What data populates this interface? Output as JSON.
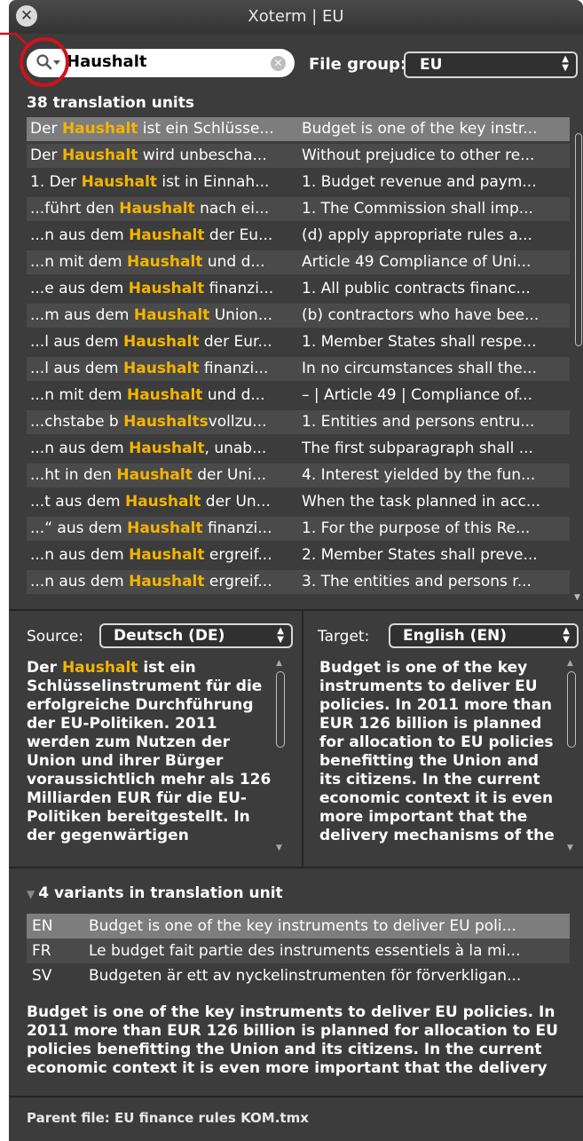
{
  "window": {
    "title": "Xoterm | EU"
  },
  "search": {
    "value": "Haushalt"
  },
  "file_group": {
    "label": "File group:",
    "value": "EU"
  },
  "count_label": "38 translation units",
  "rows": [
    {
      "src_pre": "Der ",
      "src_hl": "Haushalt",
      "src_post": " ist ein Schlüsse...",
      "tgt": "Budget is one of the key instr..."
    },
    {
      "src_pre": "Der ",
      "src_hl": "Haushalt",
      "src_post": " wird unbescha...",
      "tgt": "Without prejudice to other re..."
    },
    {
      "src_pre": "1. Der ",
      "src_hl": "Haushalt",
      "src_post": " ist in Einnah...",
      "tgt": "1. Budget revenue and paym..."
    },
    {
      "src_pre": "...führt den ",
      "src_hl": "Haushalt",
      "src_post": " nach ei...",
      "tgt": "1. The Commission shall imp..."
    },
    {
      "src_pre": "...n aus dem ",
      "src_hl": "Haushalt",
      "src_post": " der Eu...",
      "tgt": "(d) apply appropriate rules a..."
    },
    {
      "src_pre": "...n mit dem ",
      "src_hl": "Haushalt",
      "src_post": " und d...",
      "tgt": "Article 49 Compliance of Uni..."
    },
    {
      "src_pre": "...e aus dem ",
      "src_hl": "Haushalt",
      "src_post": " finanzi...",
      "tgt": "1. All public contracts financ..."
    },
    {
      "src_pre": "...m aus dem ",
      "src_hl": "Haushalt",
      "src_post": " Union...",
      "tgt": "(b) contractors who have bee..."
    },
    {
      "src_pre": "...l aus dem ",
      "src_hl": "Haushalt",
      "src_post": " der Eur...",
      "tgt": "1. Member States shall respe..."
    },
    {
      "src_pre": "...l aus dem ",
      "src_hl": "Haushalt",
      "src_post": " finanzi...",
      "tgt": "In no circumstances shall the..."
    },
    {
      "src_pre": "...n mit dem ",
      "src_hl": "Haushalt",
      "src_post": " und d...",
      "tgt": "– | Article 49 | Compliance of..."
    },
    {
      "src_pre": "...chstabe b ",
      "src_hl": "Haushalts",
      "src_post": "vollzu...",
      "tgt": "1. Entities and persons entru..."
    },
    {
      "src_pre": "...n aus dem ",
      "src_hl": "Haushalt",
      "src_post": ", unab...",
      "tgt": "The first subparagraph shall ..."
    },
    {
      "src_pre": "...ht in den ",
      "src_hl": "Haushalt",
      "src_post": " der Uni...",
      "tgt": "4. Interest yielded by the fun..."
    },
    {
      "src_pre": "...t aus dem ",
      "src_hl": "Haushalt",
      "src_post": " der Un...",
      "tgt": "When the task planned in acc..."
    },
    {
      "src_pre": "...“ aus dem ",
      "src_hl": "Haushalt",
      "src_post": " finanzi...",
      "tgt": "1. For the purpose of this Re..."
    },
    {
      "src_pre": "...n aus dem ",
      "src_hl": "Haushalt",
      "src_post": " ergreif...",
      "tgt": "2. Member States shall preve..."
    },
    {
      "src_pre": "...n aus dem ",
      "src_hl": "Haushalt",
      "src_post": " ergreif...",
      "tgt": "3. The entities and persons r..."
    }
  ],
  "source": {
    "label": "Source:",
    "language": "Deutsch (DE)",
    "hl": "Haushalt",
    "text_pre": "Der ",
    "text_post": " ist ein Schlüsselinstrument für die erfolgreiche Durchführung der EU-Politiken. 2011 werden zum Nutzen der Union und ihrer Bürger voraussichtlich mehr als 126 Milliarden EUR für die EU-Politiken bereitgestellt. In der gegenwärtigen"
  },
  "target": {
    "label": "Target:",
    "language": "English (EN)",
    "text": "Budget is one of the key instruments to deliver EU policies. In 2011 more than EUR 126 billion is planned for allocation to EU policies benefitting the Union and its citizens. In the current economic context it is even more important that the delivery mechanisms of the"
  },
  "variants": {
    "header": "4 variants in translation unit",
    "items": [
      {
        "code": "EN",
        "text": "Budget is one of the key instruments to deliver EU poli..."
      },
      {
        "code": "FR",
        "text": "Le budget fait partie des instruments essentiels à la mi..."
      },
      {
        "code": "SV",
        "text": "Budgeten är ett av nyckelinstrumenten för förverkligan..."
      }
    ],
    "detail": "Budget is one of the key instruments to deliver EU policies. In 2011 more than EUR 126 billion is planned for allocation to EU policies benefitting the Union and its citizens. In the current economic context it is even more important that the delivery"
  },
  "parent_file": "Parent file: EU finance rules KOM.tmx",
  "colors": {
    "highlight": "#f5b400",
    "selected_row": "#7d7d7d",
    "panel": "#3c3c3c",
    "callout": "#d0121b"
  }
}
